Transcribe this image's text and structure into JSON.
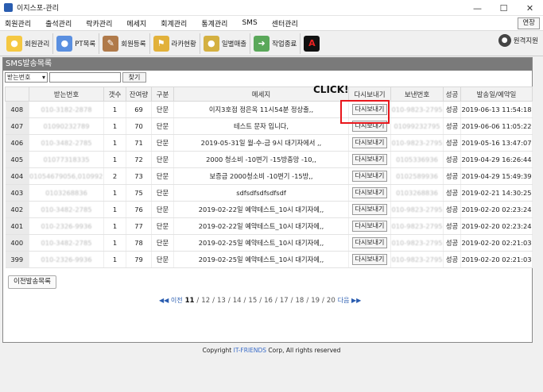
{
  "window": {
    "title": "이지스포-관리",
    "minimize": "—",
    "maximize": "☐",
    "close": "✕"
  },
  "menu": {
    "items": [
      "회원관리",
      "출석관리",
      "락카관리",
      "메세지",
      "회계관리",
      "통계관리",
      "SMS",
      "센터관리"
    ],
    "env_button": "연장"
  },
  "toolbar": {
    "buttons": [
      {
        "label": "회원관리",
        "icon": "member-icon",
        "color": "#e6b420"
      },
      {
        "label": "PT목록",
        "icon": "pt-icon",
        "color": "#3b77d4"
      },
      {
        "label": "회원등록",
        "icon": "register-icon",
        "color": "#8b5a2b"
      },
      {
        "label": "라카현황",
        "icon": "locker-icon",
        "color": "#d9a520"
      },
      {
        "label": "일별매출",
        "icon": "sales-icon",
        "color": "#c9a227"
      },
      {
        "label": "작업종료",
        "icon": "exit-icon",
        "color": "#4a9a4a"
      },
      {
        "label": "A",
        "icon": "a-icon",
        "color": "#cc1111"
      }
    ],
    "remote": "원격지원"
  },
  "panel": {
    "title": "SMS발송목록",
    "search_select": "받는번호",
    "search_button": "찾기",
    "columns": [
      "",
      "받는번호",
      "갯수",
      "잔여량",
      "구분",
      "메세지",
      "다시보내기",
      "보낸번호",
      "성공",
      "발송일/예약일"
    ],
    "rows": [
      {
        "id": "408",
        "to": "010-3182-2878",
        "cnt": "1",
        "rem": "69",
        "type": "단문",
        "msg": "이지3호점 정은옥 11시54분 정상출,,",
        "resend": "다시보내기",
        "from": "010-9823-2795",
        "ok": "성공",
        "date": "2019-06-13 11:54:18"
      },
      {
        "id": "407",
        "to": "01090232789",
        "cnt": "1",
        "rem": "70",
        "type": "단문",
        "msg": "테스트 문자 입니다,",
        "resend": "다시보내기",
        "from": "01099232795",
        "ok": "성공",
        "date": "2019-06-06 11:05:22"
      },
      {
        "id": "406",
        "to": "010-3482-2785",
        "cnt": "1",
        "rem": "71",
        "type": "단문",
        "msg": "2019-05-31일 월-수-금 9시 대기자에서 ,,",
        "resend": "다시보내기",
        "from": "010-9823-2795",
        "ok": "성공",
        "date": "2019-05-16 13:47:07"
      },
      {
        "id": "405",
        "to": "01077318335",
        "cnt": "1",
        "rem": "72",
        "type": "단문",
        "msg": "2000 청소비 -10변기 -15방충망 -10,,",
        "resend": "다시보내기",
        "from": "0105336936",
        "ok": "성공",
        "date": "2019-04-29 16:26:44"
      },
      {
        "id": "404",
        "to": "01054679056,0109922,,",
        "cnt": "2",
        "rem": "73",
        "type": "단문",
        "msg": "보증금 2000청소비 -10변기 -15방,,",
        "resend": "다시보내기",
        "from": "0102589936",
        "ok": "성공",
        "date": "2019-04-29 15:49:39"
      },
      {
        "id": "403",
        "to": "0103268836",
        "cnt": "1",
        "rem": "75",
        "type": "단문",
        "msg": "sdfsdfsdfsdfsdf",
        "resend": "다시보내기",
        "from": "0103268836",
        "ok": "성공",
        "date": "2019-02-21 14:30:25"
      },
      {
        "id": "402",
        "to": "010-3482-2785",
        "cnt": "1",
        "rem": "76",
        "type": "단문",
        "msg": "2019-02-22일 예약테스트_10시 대기자에,,",
        "resend": "다시보내기",
        "from": "010-9823-2795",
        "ok": "성공",
        "date": "2019-02-20 02:23:24"
      },
      {
        "id": "401",
        "to": "010-2326-9936",
        "cnt": "1",
        "rem": "77",
        "type": "단문",
        "msg": "2019-02-22일 예약테스트_10시 대기자에,,",
        "resend": "다시보내기",
        "from": "010-9823-2795",
        "ok": "성공",
        "date": "2019-02-20 02:23:24"
      },
      {
        "id": "400",
        "to": "010-3482-2785",
        "cnt": "1",
        "rem": "78",
        "type": "단문",
        "msg": "2019-02-25일 예약테스트_10시 대기자에,,",
        "resend": "다시보내기",
        "from": "010-9823-2795",
        "ok": "성공",
        "date": "2019-02-20 02:21:03"
      },
      {
        "id": "399",
        "to": "010-2326-9936",
        "cnt": "1",
        "rem": "79",
        "type": "단문",
        "msg": "2019-02-25일 예약테스트_10시 대기자에,,",
        "resend": "다시보내기",
        "from": "010-9823-2795",
        "ok": "성공",
        "date": "2019-02-20 02:21:03"
      }
    ],
    "click_label": "CLICK!",
    "prev_list_button": "이전발송목록",
    "pager": {
      "prev": "◀◀ 이전",
      "pages": [
        "11",
        "12",
        "13",
        "14",
        "15",
        "16",
        "17",
        "18",
        "19",
        "20"
      ],
      "current": "11",
      "next": "다음 ▶▶"
    }
  },
  "footer": {
    "prefix": "Copyright ",
    "brand": "IT-FRIENDS",
    "suffix": " Corp, All rights reserved"
  }
}
